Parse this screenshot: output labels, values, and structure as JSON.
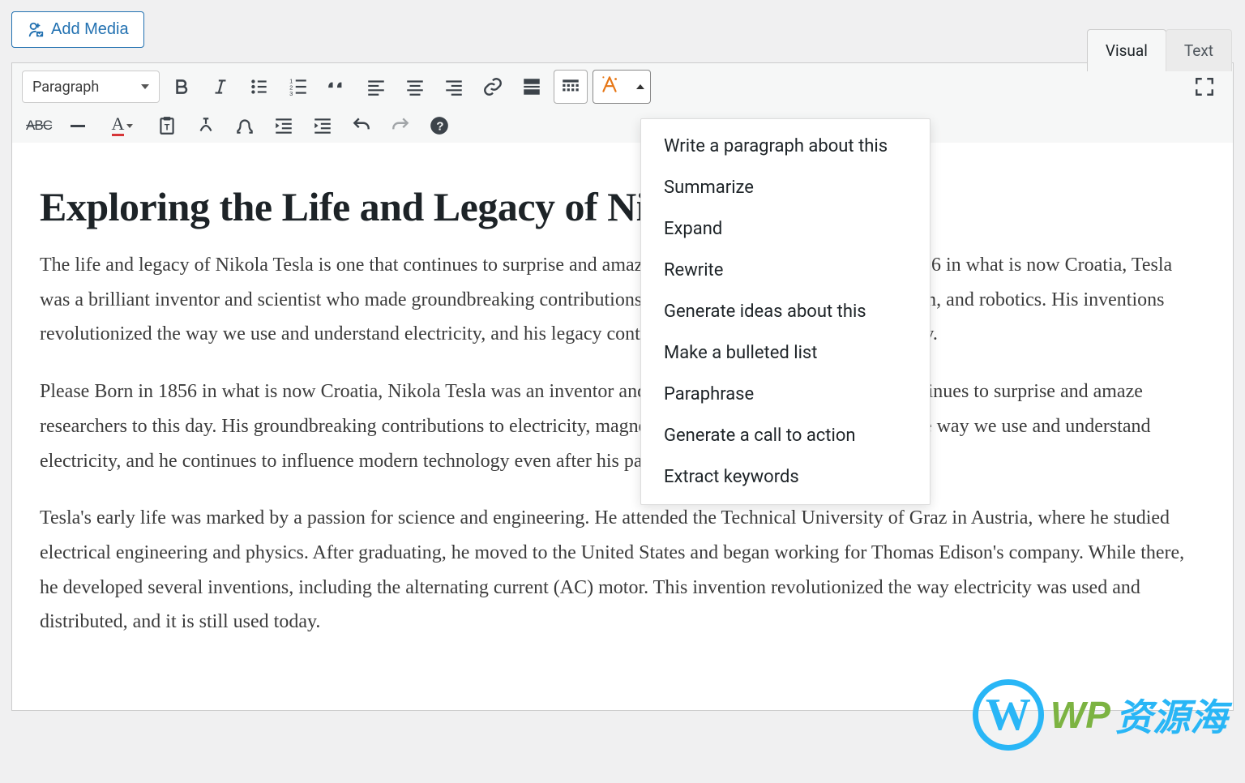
{
  "add_media_label": "Add Media",
  "tabs": {
    "visual": "Visual",
    "text": "Text"
  },
  "format_select": "Paragraph",
  "ai_menu": [
    "Write a paragraph about this",
    "Summarize",
    "Expand",
    "Rewrite",
    "Generate ideas about this",
    "Make a bulleted list",
    "Paraphrase",
    "Generate a call to action",
    "Extract keywords"
  ],
  "content": {
    "title": "Exploring the Life and Legacy of Nikola Tesla",
    "p1": "The life and legacy of Nikola Tesla is one that continues to surprise and amaze researchers to this day. Born in 1856 in what is now Croatia, Tesla was a brilliant inventor and scientist who made groundbreaking contributions to the fields of electricity, magnetism, and robotics. His inventions revolutionized the way we use and understand electricity, and his legacy continues to influence modern technology.",
    "p2": "Please Born in 1856 in what is now Croatia, Nikola Tesla was an inventor and scientist whose life and legacy continues to surprise and amaze researchers to this day. His groundbreaking contributions to electricity, magnetism, and robotics revolutionized the way we use and understand electricity, and he continues to influence modern technology even after his passing.",
    "p3": "Tesla's early life was marked by a passion for science and engineering. He attended the Technical University of Graz in Austria, where he studied electrical engineering and physics. After graduating, he moved to the United States and began working for Thomas Edison's company. While there, he developed several inventions, including the alternating current (AC) motor. This invention revolutionized the way electricity was used and distributed, and it is still used today."
  },
  "watermark": {
    "wp": "WP",
    "rest": "资源海"
  },
  "toolbar_row1": {
    "strike_label": "ABC",
    "textcolor_label": "A"
  }
}
